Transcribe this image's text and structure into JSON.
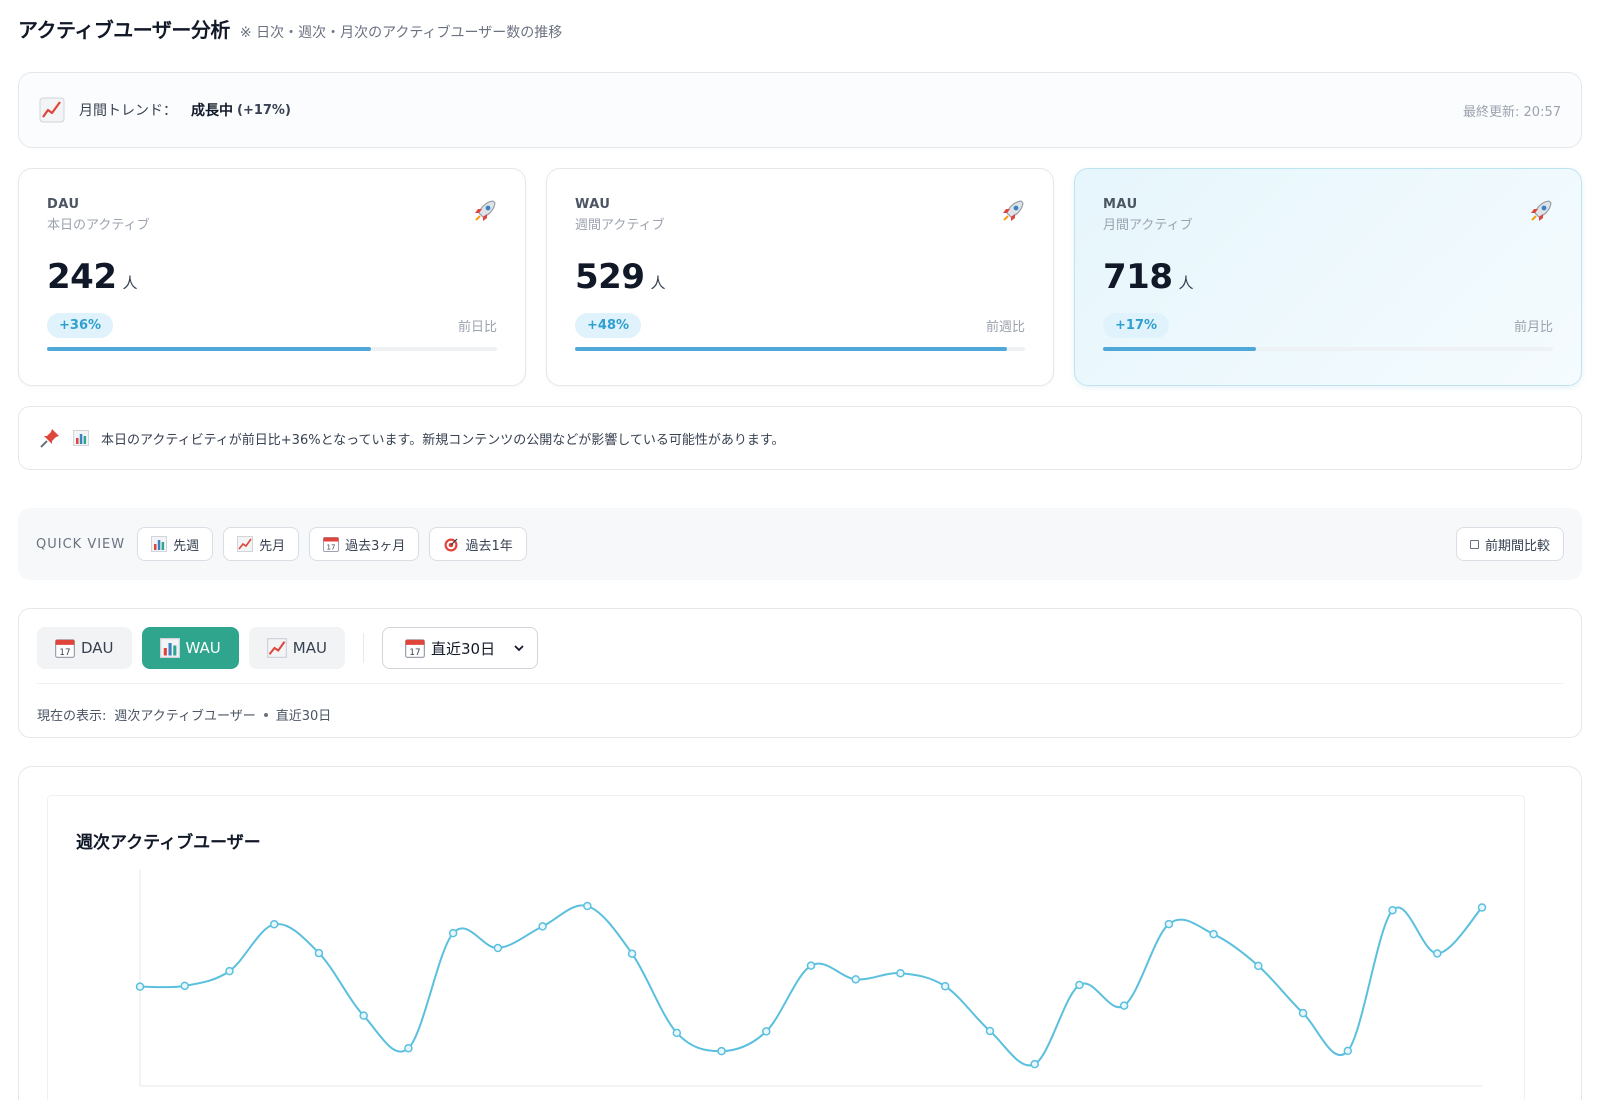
{
  "header": {
    "title": "アクティブユーザー分析",
    "subtitle": "※ 日次・週次・月次のアクティブユーザー数の推移"
  },
  "trend": {
    "label": "月間トレンド：",
    "value": "成長中",
    "percent": "(+17%)",
    "updated": "最終更新: 20:57",
    "icon": "chart-increasing-icon"
  },
  "cards": [
    {
      "code": "DAU",
      "desc": "本日のアクティブ",
      "value": "242",
      "unit": "人",
      "badge": "+36%",
      "compare": "前日比",
      "progress": 0.72,
      "icon": "rocket-icon"
    },
    {
      "code": "WAU",
      "desc": "週間アクティブ",
      "value": "529",
      "unit": "人",
      "badge": "+48%",
      "compare": "前週比",
      "progress": 0.96,
      "icon": "rocket-icon"
    },
    {
      "code": "MAU",
      "desc": "月間アクティブ",
      "value": "718",
      "unit": "人",
      "badge": "+17%",
      "compare": "前月比",
      "progress": 0.34,
      "icon": "rocket-icon"
    }
  ],
  "notice": {
    "text": "本日のアクティビティが前日比+36%となっています。新規コンテンツの公開などが影響している可能性があります。"
  },
  "quick_view": {
    "label": "QUICK VIEW",
    "buttons": [
      {
        "label": "先週",
        "icon": "bar-chart-icon"
      },
      {
        "label": "先月",
        "icon": "chart-increasing-icon"
      },
      {
        "label": "過去3ヶ月",
        "icon": "calendar-icon"
      },
      {
        "label": "過去1年",
        "icon": "target-icon"
      }
    ],
    "compare_label": "前期間比較"
  },
  "controls": {
    "metrics": [
      {
        "label": "DAU",
        "icon": "calendar-icon",
        "selected": false
      },
      {
        "label": "WAU",
        "icon": "bar-chart-icon",
        "selected": true
      },
      {
        "label": "MAU",
        "icon": "chart-increasing-icon",
        "selected": false
      }
    ],
    "range_selected": "直近30日",
    "current_view_label": "現在の表示:",
    "current_view_metric": "週次アクティブユーザー",
    "current_view_range": "直近30日"
  },
  "colors": {
    "accent_green": "#2ea58c",
    "line": "#5bc0de",
    "badge_text": "#2f9fd0",
    "progress": "#4fa8d8"
  },
  "chart_data": {
    "type": "line",
    "title": "週次アクティブユーザー",
    "series": [
      {
        "values": [
          0.473,
          0.477,
          0.547,
          0.77,
          0.633,
          0.335,
          0.18,
          0.728,
          0.657,
          0.76,
          0.857,
          0.63,
          0.253,
          0.166,
          0.26,
          0.573,
          0.508,
          0.537,
          0.475,
          0.262,
          0.104,
          0.481,
          0.383,
          0.771,
          0.723,
          0.572,
          0.347,
          0.167,
          0.837,
          0.631,
          0.85
        ]
      }
    ],
    "grid": false
  }
}
